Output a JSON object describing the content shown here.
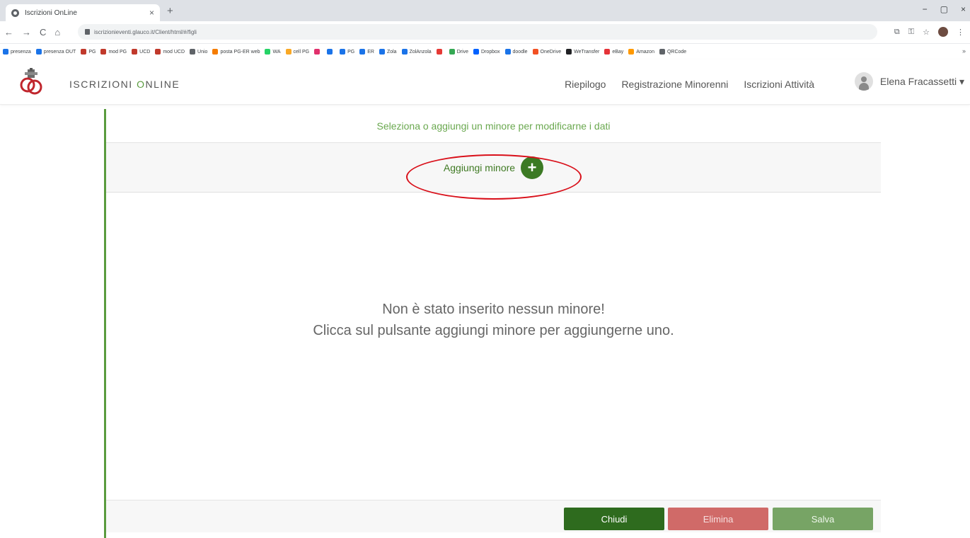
{
  "browser": {
    "tab_title": "Iscrizioni OnLine",
    "tab_close": "×",
    "new_tab": "+",
    "window_controls": [
      "−",
      "▢",
      "×"
    ],
    "nav": [
      "←",
      "→",
      "C",
      "⌂"
    ],
    "url": "iscrizionieventi.glauco.it/Client/html/#/figli",
    "right_icons": [
      "⧉",
      "⚿",
      "☆",
      "⋮"
    ]
  },
  "bookmarks": [
    {
      "label": "presenza",
      "color": "#1a73e8"
    },
    {
      "label": "presenza OUT",
      "color": "#1a73e8"
    },
    {
      "label": "PG",
      "color": "#c0392b"
    },
    {
      "label": "mod PG",
      "color": "#c0392b"
    },
    {
      "label": "UCD",
      "color": "#c0392b"
    },
    {
      "label": "mod UCD",
      "color": "#c0392b"
    },
    {
      "label": "Unio",
      "color": "#5f6368"
    },
    {
      "label": "posta PG-ER web",
      "color": "#f57c00"
    },
    {
      "label": "WA",
      "color": "#25d366"
    },
    {
      "label": "cell PG",
      "color": "#f9a825"
    },
    {
      "label": "",
      "color": "#e1306c"
    },
    {
      "label": "",
      "color": "#1a73e8"
    },
    {
      "label": "PG",
      "color": "#1a73e8"
    },
    {
      "label": "ER",
      "color": "#1a73e8"
    },
    {
      "label": "Zola",
      "color": "#1a73e8"
    },
    {
      "label": "ZolAnzola",
      "color": "#1a73e8"
    },
    {
      "label": "",
      "color": "#e53935"
    },
    {
      "label": "Drive",
      "color": "#34a853"
    },
    {
      "label": "Dropbox",
      "color": "#0061ff"
    },
    {
      "label": "doodle",
      "color": "#1a73e8"
    },
    {
      "label": "OneDrive",
      "color": "#f25022"
    },
    {
      "label": "WeTransfer",
      "color": "#202124"
    },
    {
      "label": "eBay",
      "color": "#e53238"
    },
    {
      "label": "Amazon",
      "color": "#ff9900"
    },
    {
      "label": "QRCode",
      "color": "#5f6368"
    }
  ],
  "bookmarks_more": "»",
  "app": {
    "brand_start": "ISCRIZIONI ",
    "brand_accent": "O",
    "brand_end": "NLINE",
    "nav": [
      "Riepilogo",
      "Registrazione Minorenni",
      "Iscrizioni Attività"
    ],
    "user_name": "Elena Fracassetti ▾"
  },
  "panel": {
    "title": "Seleziona o aggiungi un minore per modificarne i dati",
    "add_label": "Aggiungi minore",
    "add_icon": "+",
    "empty_line1": "Non è stato inserito nessun minore!",
    "empty_line2": "Clicca sul pulsante aggiungi minore per aggiungerne uno."
  },
  "footer": {
    "close": "Chiudi",
    "delete": "Elimina",
    "save": "Salva"
  },
  "colors": {
    "accent_green": "#5a9b3e",
    "dark_green": "#2e6b1e",
    "danger": "#d06a68",
    "highlight_red": "#d9101a"
  }
}
